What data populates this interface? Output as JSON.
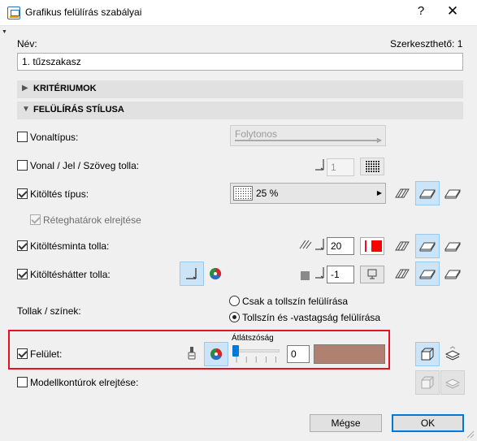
{
  "window": {
    "title": "Grafikus felülírás szabályai",
    "help": "?",
    "close": "✕"
  },
  "name": {
    "label": "Név:",
    "editable": "Szerkeszthető: 1",
    "value": "1. tűzszakasz"
  },
  "sections": {
    "criteria": "KRITÉRIUMOK",
    "style": "FELÜLÍRÁS STÍLUSA"
  },
  "rows": {
    "linetype": {
      "label": "Vonaltípus:",
      "checked": false,
      "dropdown": "Folytonos"
    },
    "linepen": {
      "label": "Vonal / Jel / Szöveg tolla:",
      "checked": false,
      "value": "1"
    },
    "filltype": {
      "label": "Kitöltés típus:",
      "checked": true,
      "dropdown": "25 %"
    },
    "hidelayers": {
      "label": "Réteghatárok elrejtése",
      "checked": true
    },
    "fillpen": {
      "label": "Kitöltésminta tolla:",
      "checked": true,
      "value": "20",
      "color": "#ff0000"
    },
    "bgpen": {
      "label": "Kitöltéshátter tolla:",
      "checked": true,
      "value": "-1"
    }
  },
  "pens": {
    "label": "Tollak / színek:",
    "options": [
      "Csak a tollszín felülírása",
      "Tollszín és -vastagság felülírása"
    ],
    "selected": 1
  },
  "surface": {
    "label": "Felület:",
    "checked": true,
    "transparency_label": "Átlátszóság",
    "transparency": "0",
    "color": "#b08070"
  },
  "model": {
    "label": "Modellkontúrok elrejtése:",
    "checked": false
  },
  "buttons": {
    "cancel": "Mégse",
    "ok": "OK"
  }
}
